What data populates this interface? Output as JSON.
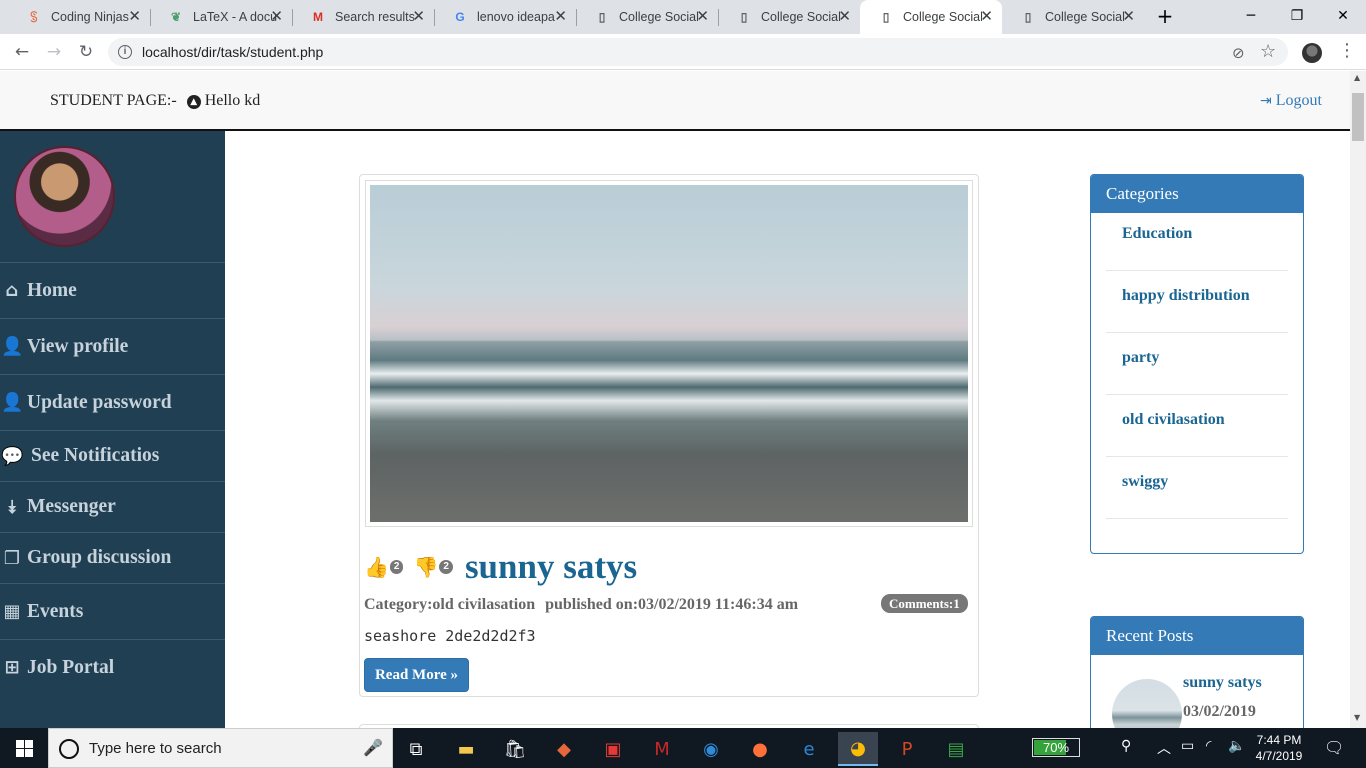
{
  "browser": {
    "tabs": [
      {
        "label": "Coding Ninjas",
        "icon": "coding-ninjas-icon",
        "glyph": "ꌗ",
        "color": "#e8663c"
      },
      {
        "label": "LaTeX - A docu",
        "icon": "overleaf-icon",
        "glyph": "❦",
        "color": "#4b9d6a"
      },
      {
        "label": "Search results",
        "icon": "gmail-icon",
        "glyph": "M",
        "color": "#d93025"
      },
      {
        "label": "lenovo ideapa",
        "icon": "google-icon",
        "glyph": "G",
        "color": "#4285f4"
      },
      {
        "label": "College Social",
        "icon": "page-icon",
        "glyph": "▯",
        "color": "#5f6368"
      },
      {
        "label": "College Social",
        "icon": "page-icon",
        "glyph": "▯",
        "color": "#5f6368"
      },
      {
        "label": "College Social",
        "icon": "page-icon",
        "glyph": "▯",
        "color": "#5f6368"
      },
      {
        "label": "College Social",
        "icon": "page-icon",
        "glyph": "▯",
        "color": "#5f6368"
      }
    ],
    "active_tab": 6,
    "url": "localhost/dir/task/student.php"
  },
  "header": {
    "student_label": "STUDENT PAGE:-",
    "greeting": "Hello kd",
    "logout": "Logout"
  },
  "sidebar": {
    "items": [
      {
        "label": "Home",
        "icon": "home-icon",
        "glyph": "⌂"
      },
      {
        "label": "View profile",
        "icon": "user-icon",
        "glyph": "👤"
      },
      {
        "label": "Update password",
        "icon": "user-icon",
        "glyph": "👤"
      },
      {
        "label": "See Notificatios",
        "icon": "comments-icon",
        "glyph": "💬"
      },
      {
        "label": "Messenger",
        "icon": "double-chevron-down-icon",
        "glyph": "⯯"
      },
      {
        "label": "Group discussion",
        "icon": "window-icon",
        "glyph": "❐"
      },
      {
        "label": "Events",
        "icon": "calendar-icon",
        "glyph": "▦"
      },
      {
        "label": "Job Portal",
        "icon": "plus-square-icon",
        "glyph": "⊞"
      }
    ]
  },
  "post": {
    "likes": "2",
    "dislikes": "2",
    "title": "sunny satys",
    "category": "Category:old civilasation",
    "published": "published on:03/02/2019 11:46:34 am",
    "comments": "Comments:1",
    "description": "seashore 2de2d2d2f3",
    "read_more": "Read More »"
  },
  "categories": {
    "title": "Categories",
    "items": [
      "Education",
      "happy distribution",
      "party",
      "old civilasation",
      "swiggy"
    ]
  },
  "recent_posts": {
    "title": "Recent Posts",
    "items": [
      {
        "title": "sunny satys",
        "date": "03/02/2019"
      }
    ]
  },
  "taskbar": {
    "search_placeholder": "Type here to search",
    "apps": [
      {
        "icon": "task-view-icon",
        "glyph": "⧉",
        "color": "#ffffff"
      },
      {
        "icon": "file-explorer-icon",
        "glyph": "▬",
        "color": "#f2c94c"
      },
      {
        "icon": "store-icon",
        "glyph": "🛍",
        "color": "#ffffff"
      },
      {
        "icon": "codeblocks-icon",
        "glyph": "◆",
        "color": "#e8663c"
      },
      {
        "icon": "readers-icon",
        "glyph": "▣",
        "color": "#e53935"
      },
      {
        "icon": "mcafee-icon",
        "glyph": "M",
        "color": "#c62828"
      },
      {
        "icon": "vpn-icon",
        "glyph": "◉",
        "color": "#2e8bd8"
      },
      {
        "icon": "firefox-icon",
        "glyph": "●",
        "color": "#ff7139"
      },
      {
        "icon": "edge-icon",
        "glyph": "e",
        "color": "#2b88d8"
      },
      {
        "icon": "chrome-icon",
        "glyph": "◕",
        "color": "#fbbc04"
      },
      {
        "icon": "powerpoint-icon",
        "glyph": "P",
        "color": "#d24726"
      },
      {
        "icon": "spreadsheet-icon",
        "glyph": "▤",
        "color": "#37a445"
      }
    ],
    "active_app": 9,
    "battery_percent": 70,
    "battery_label": "70%",
    "time": "7:44 PM",
    "date": "4/7/2019"
  }
}
